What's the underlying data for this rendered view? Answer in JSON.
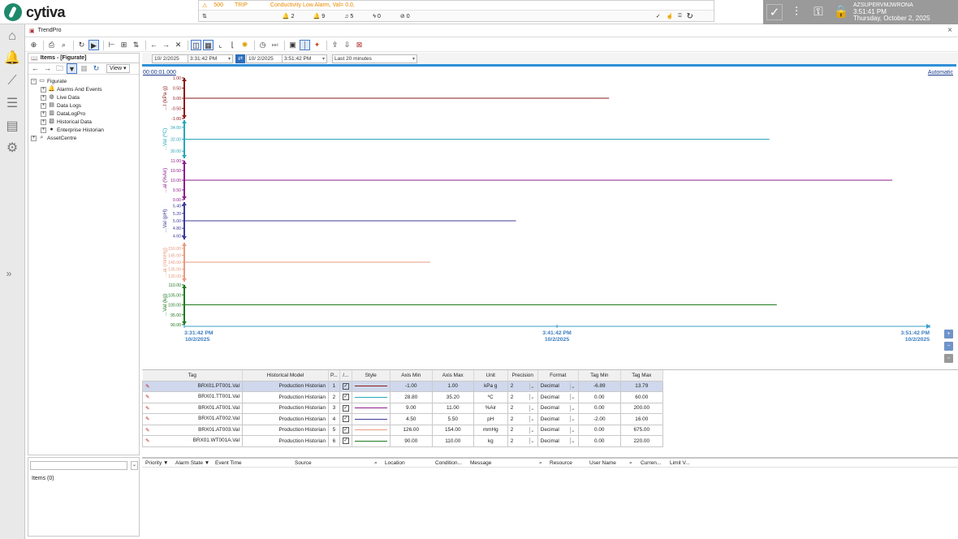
{
  "brand": {
    "name": "cytiva"
  },
  "alarm_banner": {
    "id": "500",
    "state": "TRIP",
    "message": "Conductivity Low Alarm, Val=  0.0,",
    "counts": [
      "2",
      "9",
      "5",
      "0",
      "0"
    ]
  },
  "user": {
    "name": "AZSUPERVMJWRONA",
    "time": "3:51:41 PM",
    "date": "Thursday, October 2, 2025"
  },
  "window": {
    "title": "TrendPro"
  },
  "items_panel": {
    "title": "Items - [Figurate]",
    "view_label": "View",
    "tree": [
      {
        "label": "Figurate",
        "level": 0
      },
      {
        "label": "Alarms And Events",
        "level": 1
      },
      {
        "label": "Live Data",
        "level": 1
      },
      {
        "label": "Data Logs",
        "level": 1
      },
      {
        "label": "DataLogPro",
        "level": 1
      },
      {
        "label": "Historical Data",
        "level": 1
      },
      {
        "label": "Enterprise Historian",
        "level": 1
      },
      {
        "label": "AssetCentre",
        "level": 0
      }
    ],
    "items_count": "Items (0)"
  },
  "range": {
    "start_date": "10/  2/2025",
    "start_time": "3:31:42 PM",
    "end_date": "10/  2/2025",
    "end_time": "3:51:42 PM",
    "duration": "Last 20 minutes"
  },
  "chart_header": {
    "timecode": "00:00:01.000",
    "scale_mode": "Automatic"
  },
  "chart_data": {
    "type": "line",
    "x_ticks": [
      {
        "time": "3:31:42 PM",
        "date": "10/2/2025"
      },
      {
        "time": "3:41:42 PM",
        "date": "10/2/2025"
      },
      {
        "time": "3:51:42 PM",
        "date": "10/2/2025"
      }
    ],
    "xlim_minutes": [
      0,
      20
    ],
    "series": [
      {
        "axis_label": "...I (kPa g)",
        "color": "#8b1a1a",
        "ylim": [
          -1.0,
          1.0
        ],
        "ticks": [
          "1.00",
          "0.50",
          "0.00",
          "-0.50",
          "-1.00"
        ],
        "value": 0.0,
        "end_minute": 11.4
      },
      {
        "axis_label": "...Val (ºC)",
        "color": "#2aa6b8",
        "ylim": [
          28.8,
          35.2
        ],
        "ticks": [
          "34.00",
          "32.00",
          "30.00"
        ],
        "value": 32.0,
        "end_minute": 15.7
      },
      {
        "axis_label": "...al (%Air)",
        "color": "#8e1d8e",
        "ylim": [
          9.0,
          11.0
        ],
        "ticks": [
          "11.00",
          "10.50",
          "10.00",
          "9.50",
          "9.00"
        ],
        "value": 10.0,
        "end_minute": 19.0
      },
      {
        "axis_label": "...Val (pH)",
        "color": "#3c3c9a",
        "ylim": [
          4.5,
          5.5
        ],
        "ticks": [
          "5.40",
          "5.20",
          "5.00",
          "4.80",
          "4.60"
        ],
        "value": 5.0,
        "end_minute": 8.9
      },
      {
        "axis_label": "...al (mmHg)",
        "color": "#e89a80",
        "ylim": [
          126.0,
          154.0
        ],
        "ticks": [
          "150.00",
          "145.00",
          "140.00",
          "135.00",
          "130.00"
        ],
        "value": 140.0,
        "end_minute": 6.6
      },
      {
        "axis_label": "...Val (kg)",
        "color": "#1f7a1f",
        "ylim": [
          90.0,
          110.0
        ],
        "ticks": [
          "110.00",
          "105.00",
          "100.00",
          "95.00",
          "90.00"
        ],
        "value": 100.0,
        "end_minute": 15.9
      }
    ]
  },
  "table": {
    "headers": [
      "Tag",
      "Historical Model",
      "P...",
      "/...",
      "Style",
      "Axis Min",
      "Axis Max",
      "Unit",
      "Precision",
      "Format",
      "Tag Min",
      "Tag Max"
    ],
    "rows": [
      {
        "tag": "BRX01.PT001.Val",
        "model": "Production Historian",
        "pen": "1",
        "color": "#8b1a1a",
        "axis_min": "-1.00",
        "axis_max": "1.00",
        "unit": "kPa g",
        "precision": "2",
        "format": "Decimal",
        "tag_min": "-6.89",
        "tag_max": "13.79"
      },
      {
        "tag": "BRX01.TT001.Val",
        "model": "Production Historian",
        "pen": "2",
        "color": "#2aa6b8",
        "axis_min": "28.80",
        "axis_max": "35.20",
        "unit": "ºC",
        "precision": "2",
        "format": "Decimal",
        "tag_min": "0.00",
        "tag_max": "60.00"
      },
      {
        "tag": "BRX01.AT001.Val",
        "model": "Production Historian",
        "pen": "3",
        "color": "#8e1d8e",
        "axis_min": "9.00",
        "axis_max": "11.00",
        "unit": "%Air",
        "precision": "2",
        "format": "Decimal",
        "tag_min": "0.00",
        "tag_max": "200.00"
      },
      {
        "tag": "BRX01.AT002.Val",
        "model": "Production Historian",
        "pen": "4",
        "color": "#3c3c9a",
        "axis_min": "4.50",
        "axis_max": "5.50",
        "unit": "pH",
        "precision": "2",
        "format": "Decimal",
        "tag_min": "-2.00",
        "tag_max": "16.00"
      },
      {
        "tag": "BRX01.AT003.Val",
        "model": "Production Historian",
        "pen": "5",
        "color": "#e89a80",
        "axis_min": "126.00",
        "axis_max": "154.00",
        "unit": "mmHg",
        "precision": "2",
        "format": "Decimal",
        "tag_min": "0.00",
        "tag_max": "675.00"
      },
      {
        "tag": "BRX01.WT001A.Val",
        "model": "Production Historian",
        "pen": "6",
        "color": "#1f7a1f",
        "axis_min": "90.00",
        "axis_max": "110.00",
        "unit": "kg",
        "precision": "2",
        "format": "Decimal",
        "tag_min": "0.00",
        "tag_max": "220.00"
      }
    ]
  },
  "alarm_list": {
    "headers": [
      "Priority",
      "Alarm State",
      "Event Time",
      "Source",
      "Location",
      "Condition...",
      "Message",
      "Resource",
      "User Name",
      "Curren...",
      "Limit V..."
    ]
  }
}
